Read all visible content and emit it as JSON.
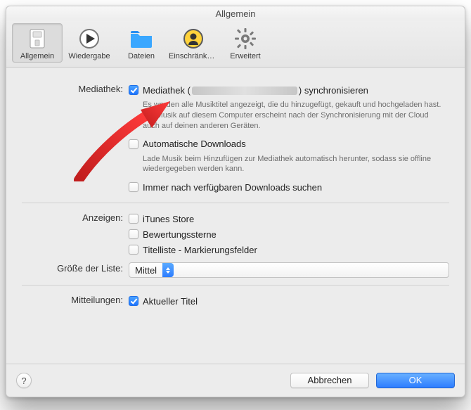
{
  "window": {
    "title": "Allgemein"
  },
  "toolbar": {
    "items": [
      {
        "key": "general",
        "label": "Allgemein",
        "icon": "switch-icon",
        "selected": true
      },
      {
        "key": "playback",
        "label": "Wiedergabe",
        "icon": "play-icon",
        "selected": false
      },
      {
        "key": "files",
        "label": "Dateien",
        "icon": "folder-icon",
        "selected": false
      },
      {
        "key": "restrictions",
        "label": "Einschränkungen",
        "icon": "restrictions-icon",
        "selected": false
      },
      {
        "key": "advanced",
        "label": "Erweitert",
        "icon": "gear-icon",
        "selected": false
      }
    ]
  },
  "section_library": {
    "label": "Mediathek:",
    "sync_prefix": "Mediathek (",
    "sync_suffix": ") synchronisieren",
    "sync_checked": true,
    "sync_desc": "Es werden alle Musiktitel angezeigt, die du hinzugefügt, gekauft und hochgeladen hast. Die Musik auf diesem Computer erscheint nach der Synchronisierung mit der Cloud auch auf deinen anderen Geräten.",
    "auto_label": "Automatische Downloads",
    "auto_checked": false,
    "auto_desc": "Lade Musik beim Hinzufügen zur Mediathek automatisch herunter, sodass sie offline wiedergegeben werden kann.",
    "check_label": "Immer nach verfügbaren Downloads suchen",
    "check_checked": false
  },
  "section_show": {
    "label": "Anzeigen:",
    "items": [
      {
        "label": "iTunes Store",
        "checked": false
      },
      {
        "label": "Bewertungssterne",
        "checked": false
      },
      {
        "label": "Titelliste - Markierungsfelder",
        "checked": false
      }
    ]
  },
  "section_listsize": {
    "label": "Größe der Liste:",
    "value": "Mittel"
  },
  "section_notifications": {
    "label": "Mitteilungen:",
    "item_label": "Aktueller Titel",
    "item_checked": true
  },
  "footer": {
    "help": "?",
    "cancel": "Abbrechen",
    "ok": "OK"
  }
}
